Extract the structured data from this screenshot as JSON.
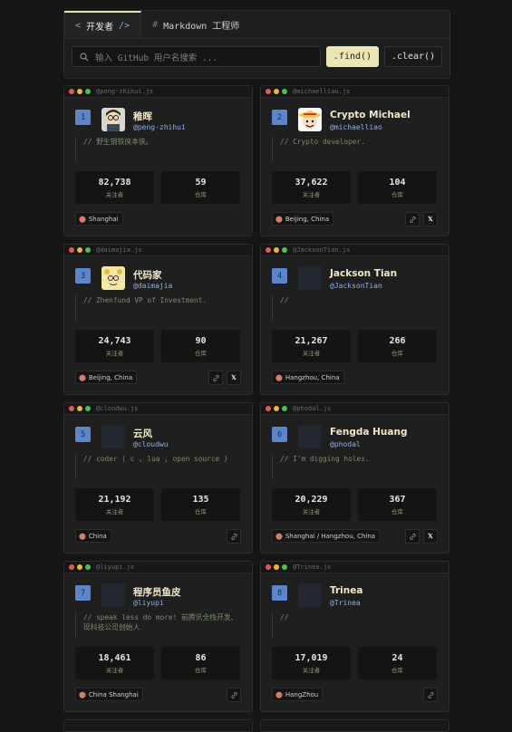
{
  "header": {
    "tab_active": "开发者",
    "tab_active_prefix": "<",
    "tab_active_suffix": "/>",
    "tab_other": "Markdown 工程师",
    "tab_other_prefix": "#",
    "search_placeholder": "输入 GitHub 用户名搜索 ...",
    "find_label": ".find()",
    "clear_label": ".clear()"
  },
  "labels": {
    "followers": "关注者",
    "repos": "仓库"
  },
  "cards": [
    {
      "file": "@peng-zhihui.js",
      "rank": "1",
      "name": "稚晖",
      "handle": "@peng-zhihui",
      "bio": "// 野生钢铁侠本侠。",
      "followers": "82,738",
      "repos": "59",
      "location": "Shanghai",
      "avatar": "glasses"
    },
    {
      "file": "@michaelliao.js",
      "rank": "2",
      "name": "Crypto Michael",
      "handle": "@michaelliao",
      "bio": "// Crypto developer.",
      "followers": "37,622",
      "repos": "104",
      "location": "Beijing, China",
      "avatar": "straw-hat"
    },
    {
      "file": "@daimajia.js",
      "rank": "3",
      "name": "代码家",
      "handle": "@daimajia",
      "bio": "// Zhenfund VP of Investment.",
      "followers": "24,743",
      "repos": "90",
      "location": "Beijing, China",
      "avatar": "cartoon"
    },
    {
      "file": "@JacksonTian.js",
      "rank": "4",
      "name": "Jackson Tian",
      "handle": "@JacksonTian",
      "bio": "//",
      "followers": "21,267",
      "repos": "266",
      "location": "Hangzhou, China",
      "avatar": "blank"
    },
    {
      "file": "@cloudwu.js",
      "rank": "5",
      "name": "云风",
      "handle": "@cloudwu",
      "bio": "// coder ( c , lua , open source )",
      "followers": "21,192",
      "repos": "135",
      "location": "China",
      "avatar": "blank"
    },
    {
      "file": "@phodal.js",
      "rank": "6",
      "name": "Fengda Huang",
      "handle": "@phodal",
      "bio": "// I'm digging holes.",
      "followers": "20,229",
      "repos": "367",
      "location": "Shanghai / Hangzhou, China",
      "avatar": "blank"
    },
    {
      "file": "@liyupi.js",
      "rank": "7",
      "name": "程序员鱼皮",
      "handle": "@liyupi",
      "bio": "// speak less do more! 前腾讯全栈开发、现科技公司创始人",
      "followers": "18,461",
      "repos": "86",
      "location": "China Shanghai",
      "avatar": "blank"
    },
    {
      "file": "@Trinea.js",
      "rank": "8",
      "name": "Trinea",
      "handle": "@Trinea",
      "bio": "//",
      "followers": "17,019",
      "repos": "24",
      "location": "HangZhou",
      "avatar": "blank"
    }
  ]
}
